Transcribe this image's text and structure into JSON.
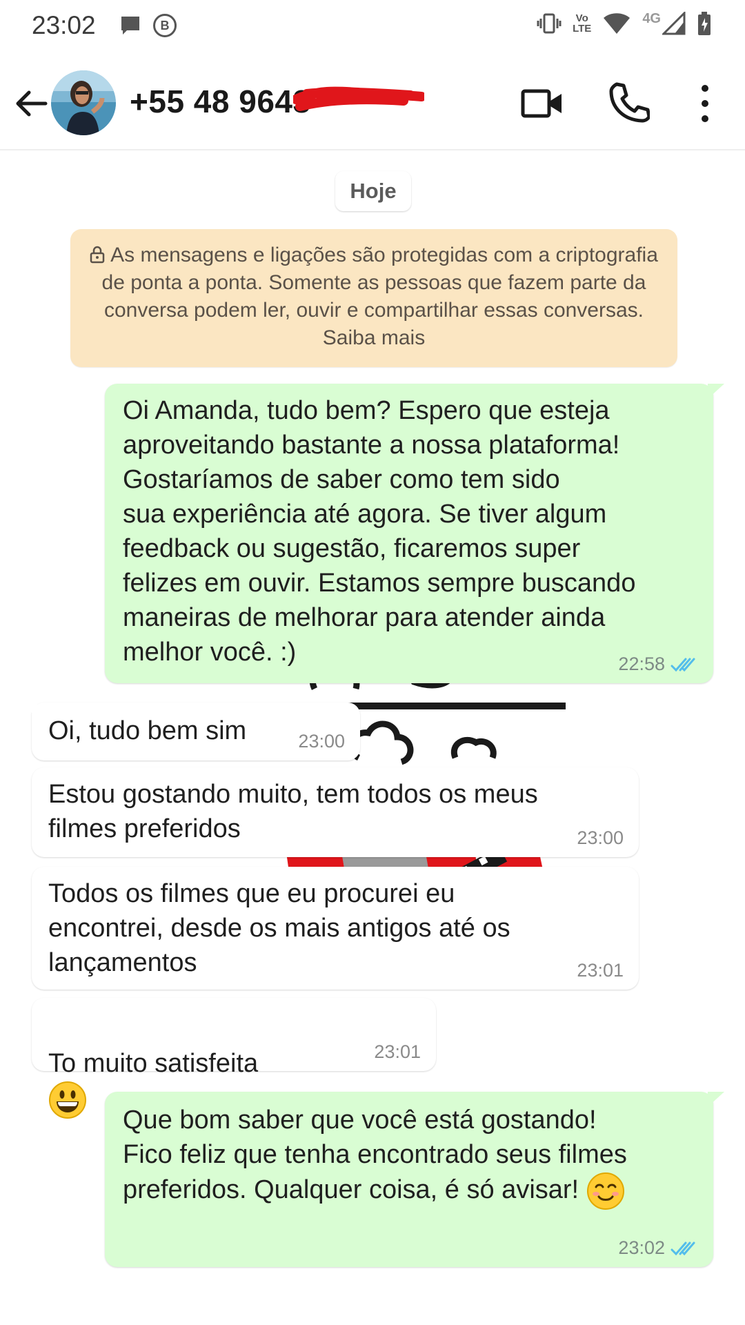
{
  "status_bar": {
    "time": "23:02",
    "left_icons": [
      "chat-notification-icon",
      "b-badge-icon"
    ],
    "badge_letter": "B",
    "right_icons": [
      "vibrate-icon",
      "volte-icon",
      "wifi-icon",
      "signal-icon",
      "battery-icon"
    ],
    "volte_label_top": "Vo",
    "volte_label_bottom": "LTE",
    "network_label": "4G"
  },
  "header": {
    "contact_name": "+55 48 9643",
    "back_icon": "arrow-left-icon",
    "video_icon": "video-call-icon",
    "call_icon": "phone-icon",
    "menu_icon": "more-vert-icon"
  },
  "chat": {
    "date_chip": "Hoje",
    "encryption_notice": "As mensagens e ligações são protegidas com a criptografia de ponta a ponta. Somente as pessoas que fazem parte da conversa podem ler, ouvir e compartilhar essas conversas. Saiba mais",
    "messages": [
      {
        "direction": "out",
        "text": "Oi Amanda, tudo bem? Espero que esteja\naproveitando bastante a nossa plataforma!\nGostaríamos de saber como tem sido\nsua experiência até agora. Se tiver algum\nfeedback ou sugestão, ficaremos super\nfelizes em ouvir. Estamos sempre buscando\nmaneiras de melhorar para atender ainda\nmelhor você. :)",
        "time": "22:58",
        "status": "read"
      },
      {
        "direction": "in",
        "text": "Oi, tudo bem sim",
        "time": "23:00"
      },
      {
        "direction": "in",
        "text": "Estou gostando muito, tem todos os meus\nfilmes preferidos",
        "time": "23:00"
      },
      {
        "direction": "in",
        "text": "Todos os filmes que eu procurei eu\nencontrei, desde os mais antigos até os\nlançamentos",
        "time": "23:01"
      },
      {
        "direction": "in",
        "text": "To muito satisfeita",
        "emoji": "grinning-face",
        "time": "23:01"
      },
      {
        "direction": "out",
        "text": "Que bom saber que você está gostando!\nFico feliz que tenha encontrado seus filmes\npreferidos. Qualquer coisa, é só avisar!",
        "emoji": "smiling-face-with-smiling-eyes",
        "time": "23:02",
        "status": "read"
      }
    ]
  },
  "colors": {
    "outgoing_bubble": "#d9fdd3",
    "incoming_bubble": "#ffffff",
    "notice_bg": "#fbe6c2",
    "read_ticks": "#53bdeb"
  }
}
